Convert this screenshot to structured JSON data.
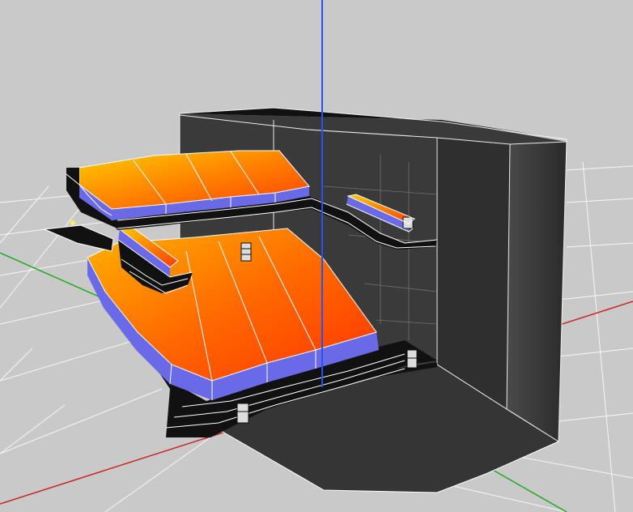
{
  "viewport": {
    "background_color": "#c9c9c9",
    "grid_color": "#ffffff",
    "axis_colors": {
      "x": "#cc2222",
      "y": "#22aa22",
      "z": "#2255ee"
    }
  },
  "model": {
    "seat_gradient": [
      "#ffd000",
      "#ff8a00",
      "#ff3800"
    ],
    "tier_edge_color": "#6666ee",
    "stage_color": "#353535",
    "wall_color": "#2e2e2e",
    "outline_color": "#ffffff"
  }
}
